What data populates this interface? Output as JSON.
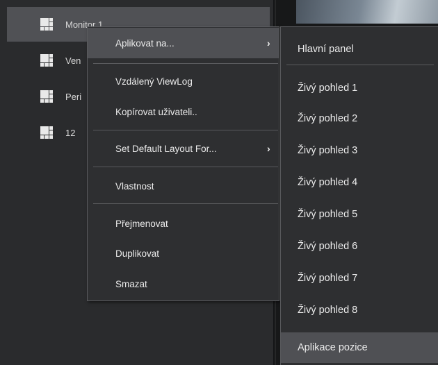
{
  "left_list": {
    "items": [
      {
        "label": "Monitor 1"
      },
      {
        "label": "Ven"
      },
      {
        "label": "Peri"
      },
      {
        "label": "12"
      }
    ]
  },
  "context_menu": {
    "apply_to": "Aplikovat na...",
    "remote_viewlog": "Vzdálený ViewLog",
    "copy_to_user": "Kopírovat uživateli..",
    "set_default_layout": "Set Default Layout For...",
    "properties": "Vlastnost",
    "rename": "Přejmenovat",
    "duplicate": "Duplikovat",
    "delete": "Smazat"
  },
  "submenu": {
    "main_panel": "Hlavní panel",
    "live_views": [
      "Živý pohled 1",
      "Živý pohled 2",
      "Živý pohled 3",
      "Živý pohled 4",
      "Živý pohled 5",
      "Živý pohled 6",
      "Živý pohled 7",
      "Živý pohled 8"
    ],
    "apply_position": "Aplikace pozice"
  },
  "colors": {
    "background": "#262728",
    "menu_bg": "#2e2f31",
    "hover_bg": "#4f5054",
    "text": "#ececec"
  }
}
